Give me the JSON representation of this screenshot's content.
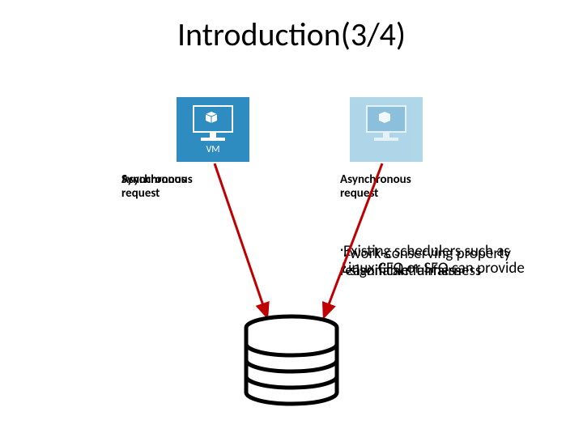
{
  "title": "Introduction(3/4)",
  "vm_left": {
    "label": "VM"
  },
  "vm_right": {
    "label": ""
  },
  "req_left_line1": "Asynchronous",
  "req_left_line1_overlay": "Synchronous",
  "req_left_line2": "request",
  "req_right_line1": "Asynchronous",
  "req_right_line2": "request",
  "blurb": {
    "l1": "Existing schedulers such as",
    "l2": "∵work-conserving property",
    "l3": "Linux CFQ or SFQ can provide",
    "l4": "∴significant unfairness",
    "l4_under": "reasonable fairness"
  }
}
